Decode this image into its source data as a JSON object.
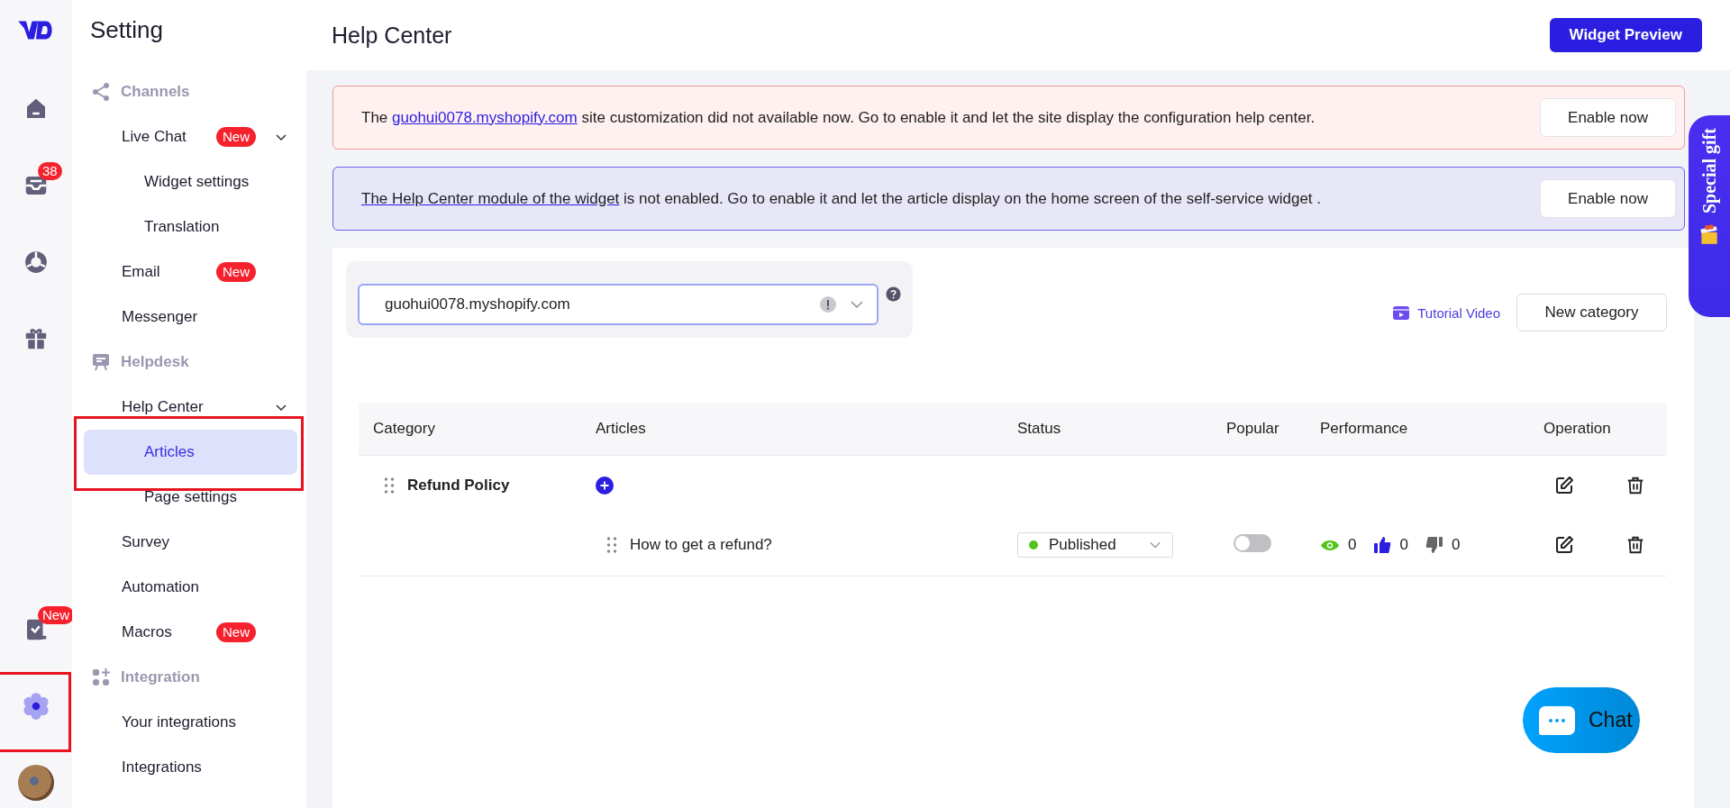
{
  "rail": {
    "items": [
      {
        "kind": "home",
        "selected": false
      },
      {
        "kind": "inbox",
        "selected": false,
        "badge": "38"
      },
      {
        "kind": "reports",
        "selected": false
      },
      {
        "kind": "gift",
        "selected": false
      }
    ],
    "bottom_items": [
      {
        "kind": "tasks",
        "selected": false,
        "badge": "New"
      },
      {
        "kind": "settings",
        "selected": true,
        "highlighted": true
      },
      {
        "kind": "avatar"
      }
    ]
  },
  "sidebar": {
    "title": "Setting",
    "sections": [
      {
        "label": "Channels",
        "kind": "share",
        "items": [
          {
            "label": "Live Chat",
            "badge": "New",
            "expanded": true,
            "selected": false,
            "children": [
              {
                "label": "Widget settings",
                "selected": false
              },
              {
                "label": "Translation",
                "selected": false
              }
            ]
          },
          {
            "label": "Email",
            "badge": "New",
            "selected": false
          },
          {
            "label": "Messenger",
            "selected": false
          }
        ]
      },
      {
        "label": "Helpdesk",
        "kind": "board",
        "items": [
          {
            "label": "Help Center",
            "expanded": true,
            "selected": false,
            "children": [
              {
                "label": "Articles",
                "selected": true,
                "highlighted": true
              },
              {
                "label": "Page settings",
                "selected": false
              }
            ]
          },
          {
            "label": "Survey",
            "selected": false
          },
          {
            "label": "Automation",
            "selected": false
          },
          {
            "label": "Macros",
            "badge": "New",
            "selected": false
          }
        ]
      },
      {
        "label": "Integration",
        "kind": "apps",
        "items": [
          {
            "label": "Your integrations",
            "selected": false
          },
          {
            "label": "Integrations",
            "selected": false
          }
        ]
      }
    ]
  },
  "header": {
    "title": "Help Center",
    "button": "Widget Preview"
  },
  "banners": [
    {
      "kind": "warning",
      "before": "The ",
      "link": "guohui0078.myshopify.com",
      "after": " site customization did not available now. Go to enable it and let the site display the configuration help center.",
      "button": "Enable now"
    },
    {
      "kind": "info",
      "link": "The Help Center module of the widget",
      "after": " is not enabled. Go to enable it and let the article display on the home screen of the self-service widget .",
      "button": "Enable now"
    }
  ],
  "store_select": {
    "value": "guohui0078.myshopify.com"
  },
  "tutorial_video": "Tutorial Video",
  "new_category": "New category",
  "table": {
    "columns": [
      "Category",
      "Articles",
      "Status",
      "Popular",
      "Performance",
      "Operation"
    ],
    "categories": [
      {
        "name": "Refund Policy",
        "articles": [
          {
            "title": "How to get a refund?",
            "status": {
              "label": "Published",
              "color": "#52c41a"
            },
            "popular": false,
            "views": "0",
            "likes": "0",
            "dislikes": "0"
          }
        ]
      }
    ]
  },
  "special_gift": "Special gift",
  "chat": {
    "label": "Chat"
  }
}
